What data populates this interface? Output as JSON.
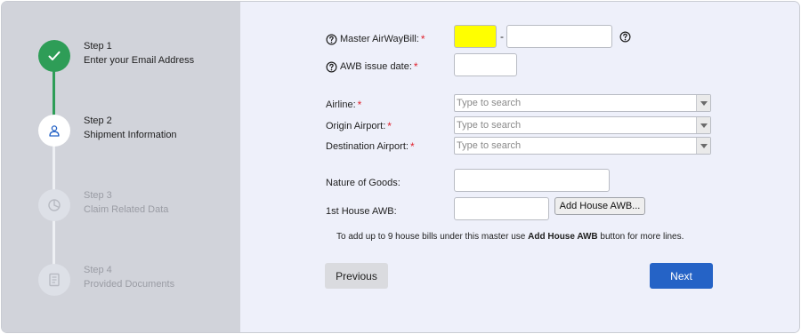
{
  "steps": [
    {
      "num": "Step 1",
      "title": "Enter your Email Address",
      "state": "done",
      "icon": "check-icon"
    },
    {
      "num": "Step 2",
      "title": "Shipment Information",
      "state": "current",
      "icon": "user-icon"
    },
    {
      "num": "Step 3",
      "title": "Claim Related Data",
      "state": "pending",
      "icon": "pie-chart-icon"
    },
    {
      "num": "Step 4",
      "title": "Provided Documents",
      "state": "pending",
      "icon": "document-icon"
    }
  ],
  "form": {
    "master_awb_label": "Master AirWayBill:",
    "awb_separator": "-",
    "awb_issue_date_label": "AWB issue date:",
    "airline_label": "Airline:",
    "origin_label": "Origin Airport:",
    "destination_label": "Destination Airport:",
    "search_placeholder": "Type to search",
    "nature_label": "Nature of Goods:",
    "house_awb_label": "1st House AWB:",
    "add_house_button": "Add House AWB...",
    "note_prefix": "To add up to 9 house bills under this master use ",
    "note_bold": "Add House AWB",
    "note_suffix": " button for more lines.",
    "required_mark": "*"
  },
  "buttons": {
    "previous": "Previous",
    "next": "Next"
  },
  "colors": {
    "done": "#2e9d57",
    "primary": "#2563c6",
    "required": "#e0232e",
    "highlight": "#ffff00"
  }
}
